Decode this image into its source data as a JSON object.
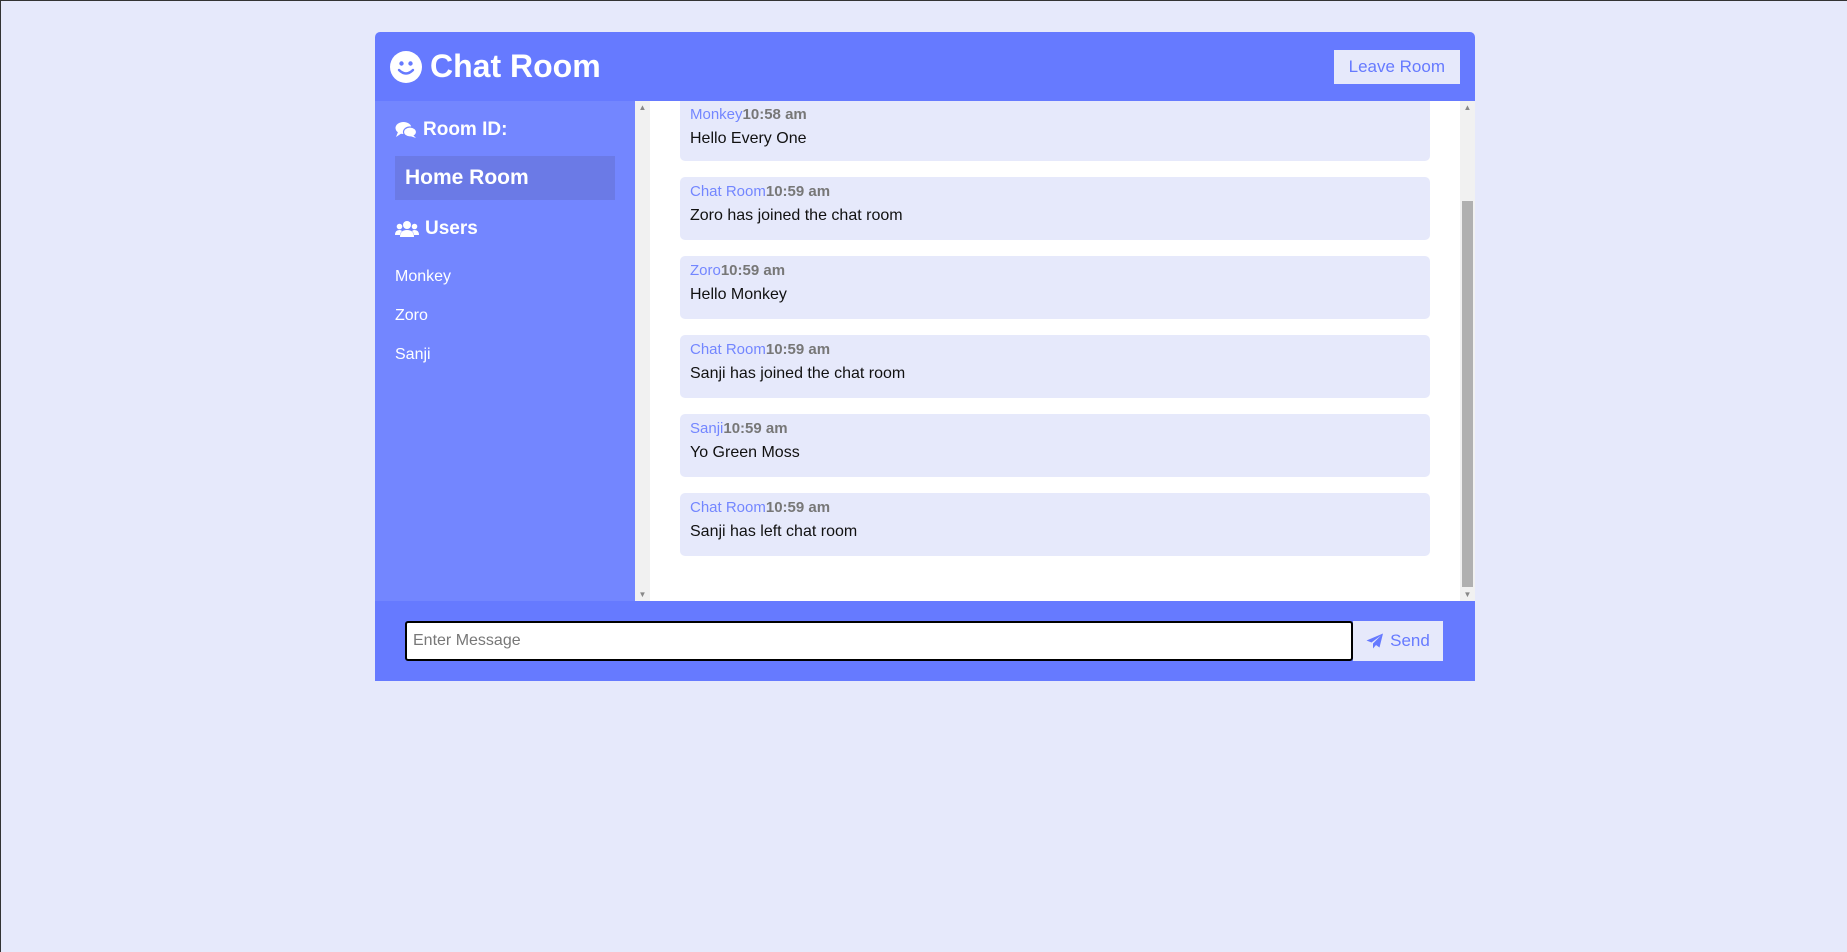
{
  "header": {
    "title": "Chat Room",
    "leave_label": "Leave Room"
  },
  "sidebar": {
    "room_heading": "Room ID:",
    "room_name": "Home Room",
    "users_heading": "Users",
    "users": [
      "Monkey",
      "Zoro",
      "Sanji"
    ]
  },
  "messages": [
    {
      "user": "Monkey",
      "time": "10:58 am",
      "text": "Hello Every One"
    },
    {
      "user": "Chat Room",
      "time": "10:59 am",
      "text": "Zoro has joined the chat room"
    },
    {
      "user": "Zoro",
      "time": "10:59 am",
      "text": "Hello Monkey"
    },
    {
      "user": "Chat Room",
      "time": "10:59 am",
      "text": "Sanji has joined the chat room"
    },
    {
      "user": "Sanji",
      "time": "10:59 am",
      "text": "Yo Green Moss"
    },
    {
      "user": "Chat Room",
      "time": "10:59 am",
      "text": "Sanji has left chat room"
    }
  ],
  "form": {
    "placeholder": "Enter Message",
    "value": "",
    "send_label": "Send"
  },
  "colors": {
    "primary": "#667aff",
    "sidebar": "#7386ff",
    "background": "#e6e9fb"
  }
}
